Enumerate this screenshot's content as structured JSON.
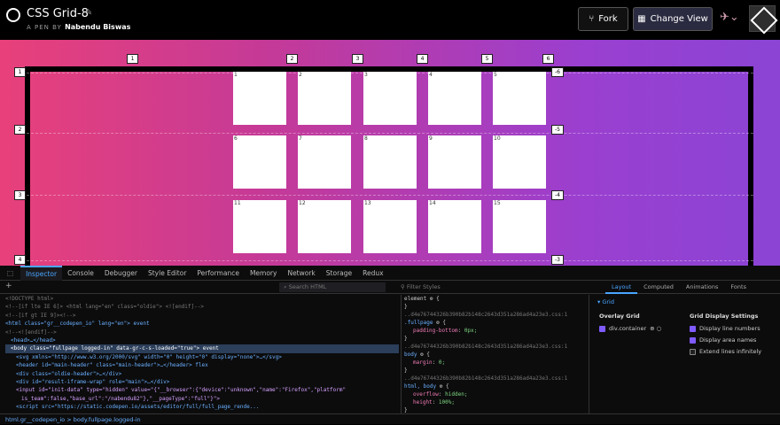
{
  "header": {
    "title": "CSS Grid-8",
    "byline_prefix": "A PEN BY",
    "author": "Nabendu Biswas",
    "fork_label": "Fork",
    "change_view_label": "Change View"
  },
  "grid": {
    "col_lines": [
      "1",
      "2",
      "3",
      "4",
      "5",
      "6"
    ],
    "row_lines": [
      "1",
      "2",
      "3",
      "4"
    ],
    "neg_row_lines": [
      "-6",
      "-5",
      "-4",
      "-3"
    ],
    "cells": [
      "1",
      "2",
      "3",
      "4",
      "5",
      "6",
      "7",
      "8",
      "9",
      "10",
      "11",
      "12",
      "13",
      "14",
      "15"
    ]
  },
  "devtools": {
    "tabs": [
      "Inspector",
      "Console",
      "Debugger",
      "Style Editor",
      "Performance",
      "Memory",
      "Network",
      "Storage",
      "Redux"
    ],
    "search_placeholder": "Search HTML",
    "filter_placeholder": "Filter Styles",
    "layout_tabs": [
      "Layout",
      "Computed",
      "Animations",
      "Fonts"
    ],
    "tree": [
      "<!DOCTYPE html>",
      "<!--[if lte IE 6]> <html lang=\"en\" class=\"oldie\"> <![endif]-->",
      "<!--[if gt IE 9]><!-->",
      "<html class=\"gr__codepen_io\" lang=\"en\"> event",
      "<!--<![endif]-->",
      "<head>…</head>",
      "<body class=\"fullpage logged-in\" data-gr-c-s-loaded=\"true\"> event",
      "<svg xmlns=\"http://www.w3.org/2000/svg\" width=\"0\" height=\"0\" display=\"none\">…</svg>",
      "<header id=\"main-header\" class=\"main-header\">…</header> flex",
      "<div class=\"oldie-header\">…</div>",
      "<div id=\"result-iframe-wrap\" role=\"main\">…</div>",
      "<input id=\"init-data\" type=\"hidden\" value=\"{\"__browser\":{\"device\":\"unknown\",\"name\":\"Firefox\",\"platform\"",
      "is_team\":false,\"base_url\":\"/nabendu82\"},\"__pageType\":\"full\"}\">",
      "<script src=\"https://static.codepen.io/assets/editor/full/full_page_rende..."
    ],
    "rules": {
      "element": "element",
      "src": "..d4e76744326b390b82b148c2643d351a286ad4a23e3.css:1",
      "r1_sel": ".fullpage",
      "r1_prop": "padding-bottom",
      "r1_val": "0px;",
      "r2_sel": "body",
      "r2_prop": "margin",
      "r2_val": "0;",
      "r3_sel": "html, body",
      "r3_p1": "overflow",
      "r3_v1": "hidden;",
      "r3_p2": "height",
      "r3_v2": "100%;"
    },
    "layout": {
      "grid_label": "Grid",
      "overlay_label": "Overlay Grid",
      "container_label": "div.container",
      "settings_label": "Grid Display Settings",
      "opt1": "Display line numbers",
      "opt2": "Display area names",
      "opt3": "Extend lines infinitely"
    },
    "breadcrumb": "html.gr__codepen_io  >  body.fullpage.logged-in"
  },
  "colors": {
    "accent": "#4aa6ff",
    "gradient_start": "#e8407a",
    "gradient_end": "#8b44d4"
  }
}
